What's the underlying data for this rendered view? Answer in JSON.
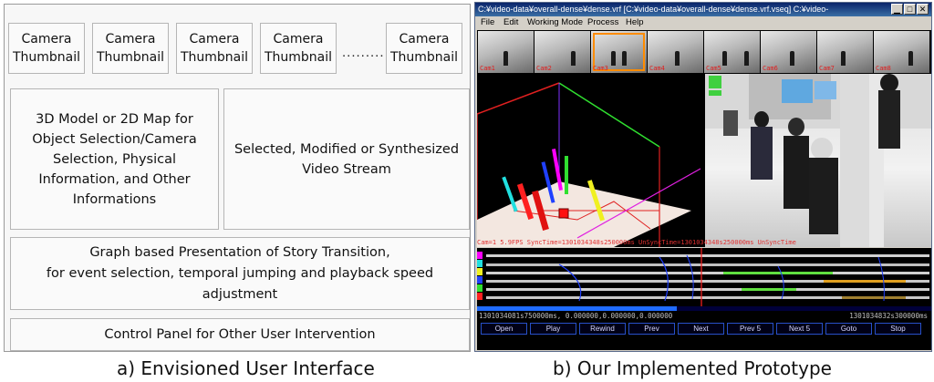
{
  "left": {
    "thumbnails": [
      "Camera\nThumbnail",
      "Camera\nThumbnail",
      "Camera\nThumbnail",
      "Camera\nThumbnail",
      "Camera\nThumbnail"
    ],
    "dots": ".........",
    "map_panel": "3D Model or 2D Map for Object Selection/Camera Selection, Physical Information, and Other Informations",
    "video_panel": "Selected, Modified or Synthesized Video Stream",
    "graph_panel_line1": "Graph based Presentation of Story Transition,",
    "graph_panel_line2": "for event selection, temporal jumping and playback speed adjustment",
    "control_panel": "Control Panel for Other User Intervention",
    "caption": "a) Envisioned User Interface"
  },
  "right": {
    "window_title": "C:¥video-data¥overall-dense¥dense.vrf [C:¥video-data¥overall-dense¥dense.vrf.vseq] C:¥video-",
    "menu": [
      "File",
      "Edit",
      "Working Mode",
      "Process",
      "Help"
    ],
    "camera_labels": [
      "Cam1",
      "Cam2",
      "Cam3",
      "Cam4",
      "Cam5",
      "Cam6",
      "Cam7",
      "Cam8"
    ],
    "status_text": "Cam=1 5.9FPS SyncTime=1301034348s250000ms UnSyncTime=1301034348s250000ms UnSyncTime",
    "progress": 0.44,
    "timestamp_left": "1301034081s750000ms, 0.000000,0.000000,0.000000",
    "timestamp_right": "1301034832s300000ms",
    "buttons": [
      "Open",
      "Play",
      "Rewind",
      "Prev",
      "Next",
      "Prev 5",
      "Next 5",
      "Goto",
      "Stop"
    ],
    "caption": "b) Our Implemented Prototype"
  },
  "colors": {
    "button_border": "#2850c8",
    "progress_fill": "#1f6bff",
    "thumb_highlight": "#ff8c00",
    "status_red": "#e03030"
  }
}
